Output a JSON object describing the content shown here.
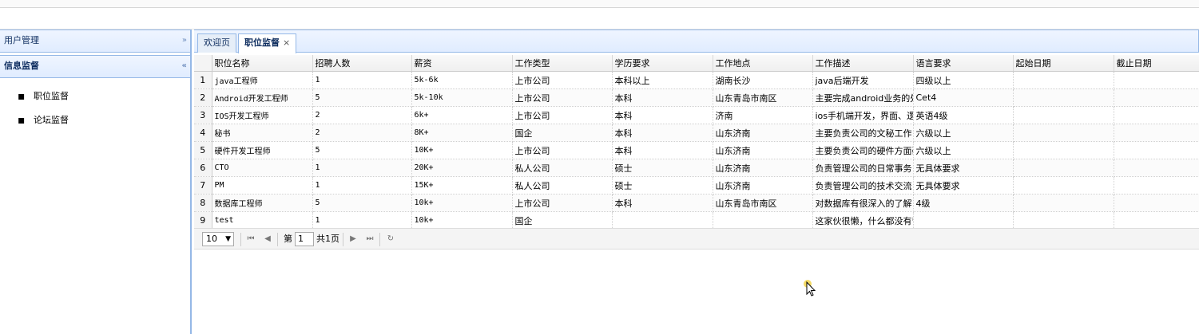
{
  "sidebar": {
    "sections": [
      {
        "title": "用户管理",
        "toggle": "»"
      },
      {
        "title": "信息监督",
        "toggle": "«"
      }
    ],
    "items": [
      {
        "label": "职位监督"
      },
      {
        "label": "论坛监督"
      }
    ]
  },
  "tabs": [
    {
      "label": "欢迎页"
    },
    {
      "label": "职位监督",
      "close": "×"
    }
  ],
  "grid": {
    "columns": [
      "职位名称",
      "招聘人数",
      "薪资",
      "工作类型",
      "学历要求",
      "工作地点",
      "工作描述",
      "语言要求",
      "起始日期",
      "截止日期"
    ],
    "rows": [
      [
        "1",
        "java工程师",
        "1",
        "5k-6k",
        "上市公司",
        "本科以上",
        "湖南长沙",
        "java后端开发",
        "四级以上",
        "",
        ""
      ],
      [
        "2",
        "Android开发工程师",
        "5",
        "5k-10k",
        "上市公司",
        "本科",
        "山东青岛市南区",
        "主要完成android业务的处理",
        "Cet4",
        "",
        ""
      ],
      [
        "3",
        "IOS开发工程师",
        "2",
        "6k+",
        "上市公司",
        "本科",
        "济南",
        "ios手机端开发，界面、逻辑",
        "英语4级",
        "",
        ""
      ],
      [
        "4",
        "秘书",
        "2",
        "8K+",
        "国企",
        "本科",
        "山东济南",
        "主要负责公司的文秘工作，",
        "六级以上",
        "",
        ""
      ],
      [
        "5",
        "硬件开发工程师",
        "5",
        "10K+",
        "上市公司",
        "本科",
        "山东济南",
        "主要负责公司的硬件方面研发",
        "六级以上",
        "",
        ""
      ],
      [
        "6",
        "CTO",
        "1",
        "20K+",
        "私人公司",
        "硕士",
        "山东济南",
        "负责管理公司的日常事务，",
        "无具体要求",
        "",
        ""
      ],
      [
        "7",
        "PM",
        "1",
        "15K+",
        "私人公司",
        "硕士",
        "山东济南",
        "负责管理公司的技术交流，",
        "无具体要求",
        "",
        ""
      ],
      [
        "8",
        "数据库工程师",
        "5",
        "10k+",
        "上市公司",
        "本科",
        "山东青岛市南区",
        "对数据库有很深入的了解，",
        "4级",
        "",
        ""
      ],
      [
        "9",
        "test",
        "1",
        "10k+",
        "国企",
        "",
        "",
        "这家伙很懒，什么都没有留下",
        "",
        "",
        ""
      ]
    ]
  },
  "pager": {
    "page_size": "10",
    "page_prefix": "第",
    "page_value": "1",
    "page_suffix": "共1页",
    "first_icon": "⏮",
    "prev_icon": "◀",
    "next_icon": "▶",
    "last_icon": "⏭",
    "refresh_icon": "↻"
  },
  "colors": {
    "accent_border": "#95b8e7",
    "header_gradient_top": "#eff5ff",
    "header_gradient_bottom": "#e0ecff"
  }
}
